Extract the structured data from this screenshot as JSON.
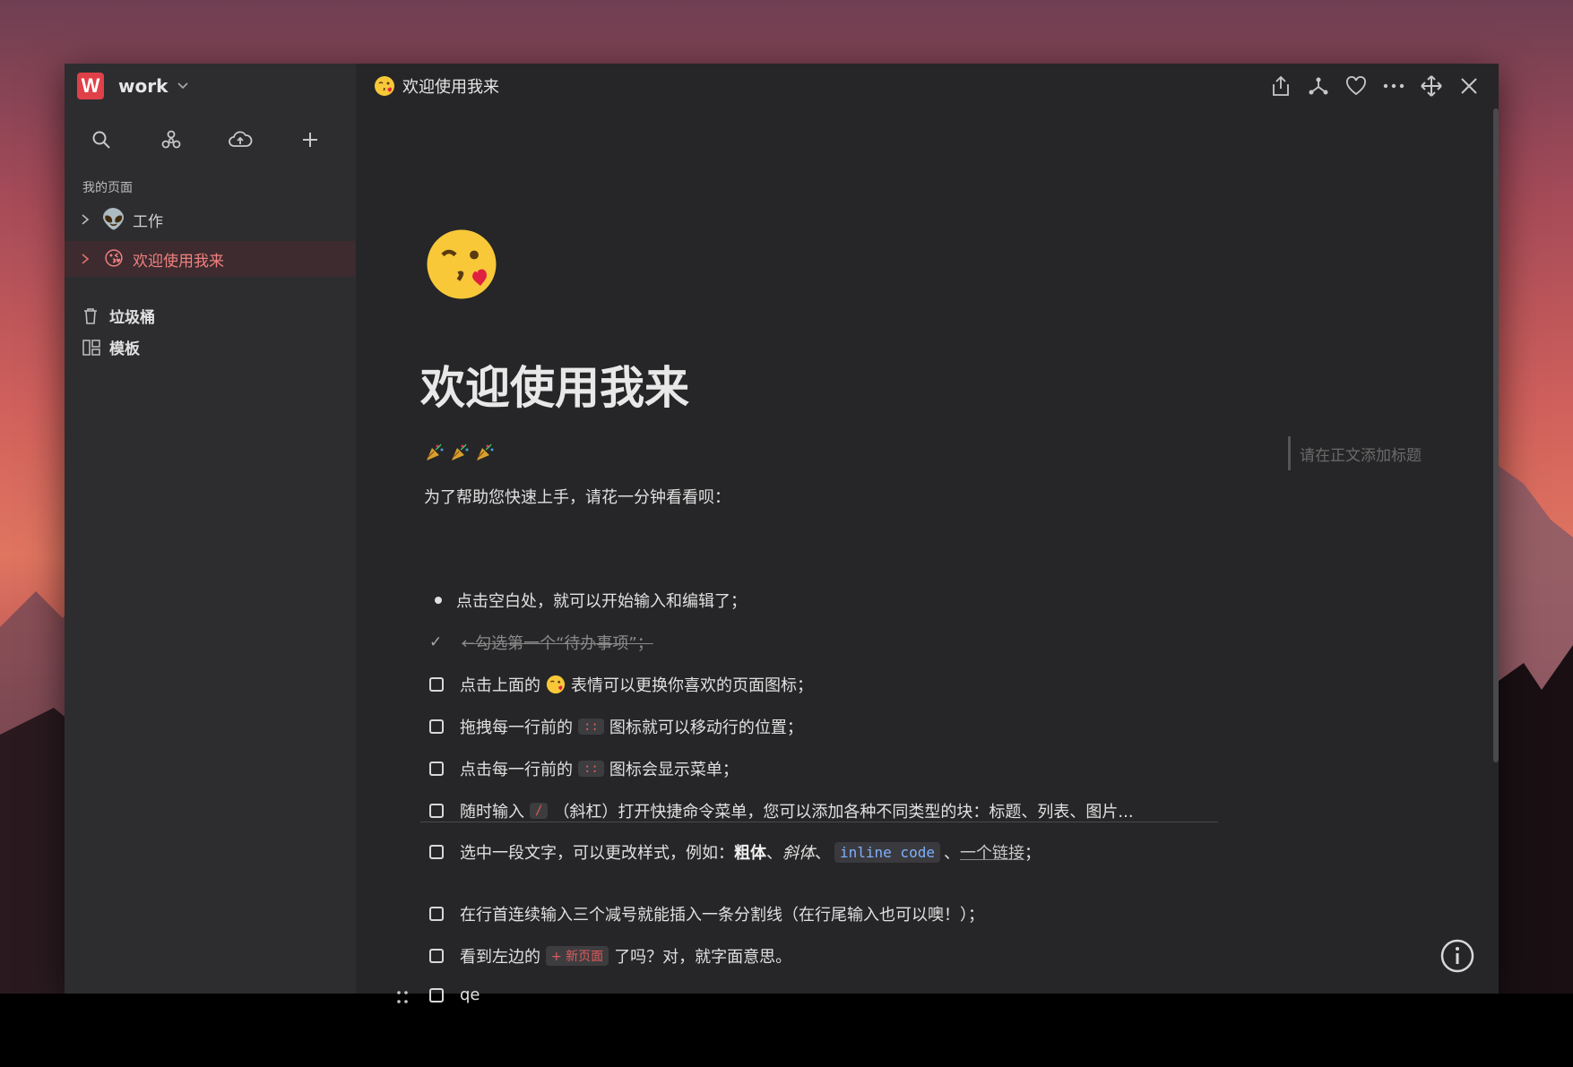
{
  "workspace": {
    "logo_letter": "W",
    "name": "work"
  },
  "sidebar": {
    "section_label": "我的页面",
    "pages": [
      {
        "emoji": "👽",
        "label": "工作"
      },
      {
        "emoji": "😘",
        "label": "欢迎使用我来",
        "active": true
      }
    ],
    "trash_label": "垃圾桶",
    "templates_label": "模板"
  },
  "topbar": {
    "title": "欢迎使用我来"
  },
  "doc": {
    "title": "欢迎使用我来",
    "intro": "为了帮助您快速上手，请花一分钟看看呗：",
    "bullet": "点击空白处，就可以开始输入和编辑了；",
    "done_todo": "←勾选第一个“待办事项”；",
    "todo1_before": "点击上面的",
    "todo1_after": "表情可以更换你喜欢的页面图标；",
    "todo2_before": "拖拽每一行前的",
    "todo2_chip": "::",
    "todo2_after": "图标就可以移动行的位置；",
    "todo3_before": "点击每一行前的",
    "todo3_chip": "::",
    "todo3_after": "图标会显示菜单；",
    "todo4_before": "随时输入",
    "todo4_chip": "/",
    "todo4_after": "（斜杠）打开快捷命令菜单，您可以添加各种不同类型的块：标题、列表、图片...",
    "todo5_before": "选中一段文字，可以更改样式，例如：",
    "todo5_bold": "粗体",
    "todo5_sep1": "、",
    "todo5_italic": "斜体",
    "todo5_sep2": "、",
    "todo5_code": "inline code",
    "todo5_sep3": "、",
    "todo5_link": "一个链接",
    "todo5_end": "；",
    "todo6": "在行首连续输入三个减号就能插入一条分割线（在行尾输入也可以噢！）；",
    "todo7_before": "看到左边的",
    "todo7_chip": "+ 新页面",
    "todo7_after": "了吗？对，就字面意思。",
    "todo8": "qe"
  },
  "toc_placeholder": "请在正文添加标题"
}
